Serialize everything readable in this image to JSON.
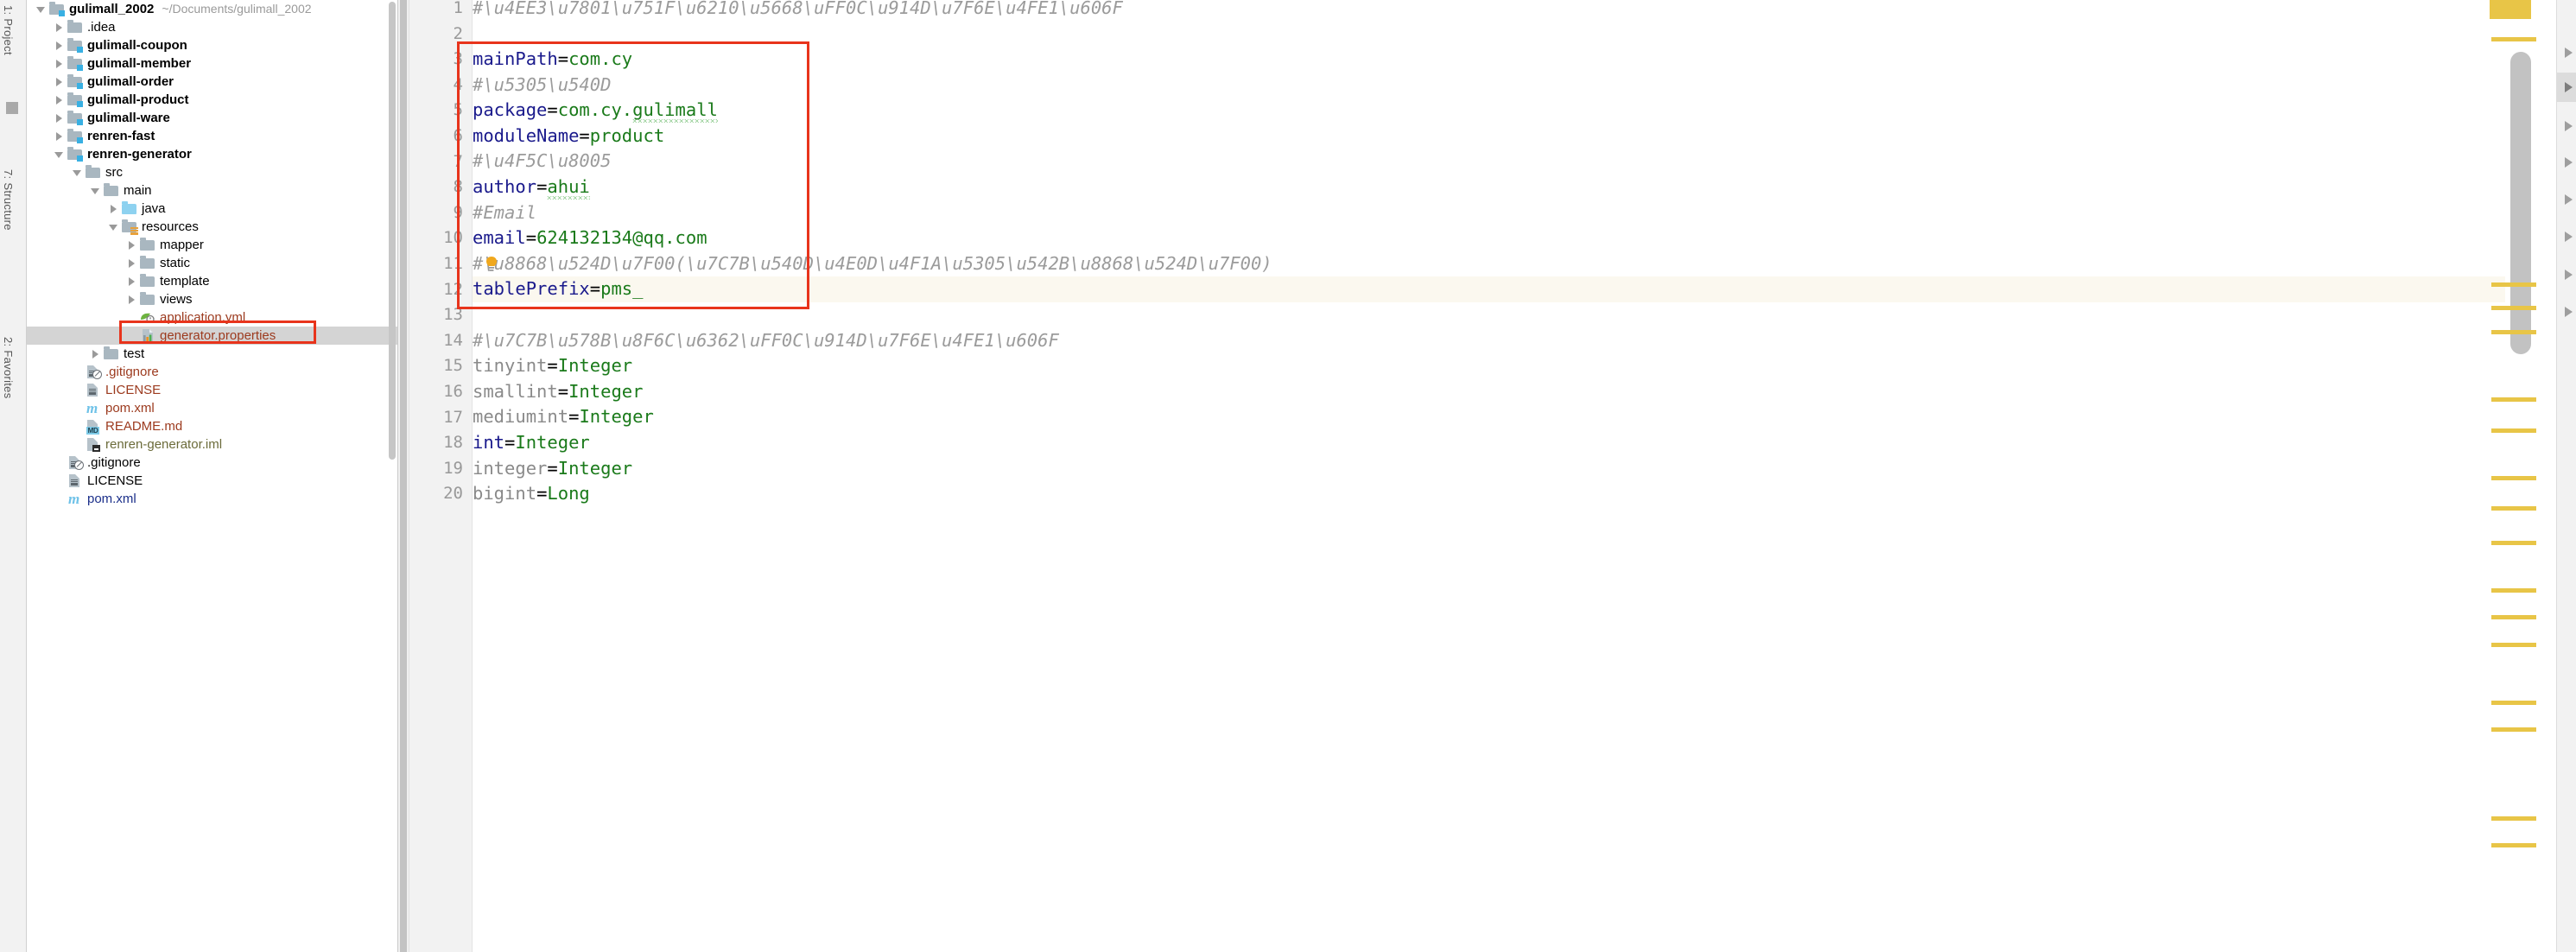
{
  "left_strip": {
    "tabs": [
      {
        "label": "1: Project"
      },
      {
        "label": "7: Structure"
      },
      {
        "label": "2: Favorites"
      }
    ]
  },
  "project_tree": {
    "panel_name": "Project",
    "items": [
      {
        "indent": 0,
        "arrow": "open",
        "icon": "module-folder-icon",
        "label": "gulimall_2002",
        "bold": true,
        "color": "black",
        "path": "~/Documents/gulimall_2002",
        "selected": false
      },
      {
        "indent": 1,
        "arrow": "closed",
        "icon": "folder-icon",
        "label": ".idea",
        "bold": false,
        "color": "black",
        "path": "",
        "selected": false
      },
      {
        "indent": 1,
        "arrow": "closed",
        "icon": "module-folder-icon",
        "label": "gulimall-coupon",
        "bold": true,
        "color": "black",
        "path": "",
        "selected": false
      },
      {
        "indent": 1,
        "arrow": "closed",
        "icon": "module-folder-icon",
        "label": "gulimall-member",
        "bold": true,
        "color": "black",
        "path": "",
        "selected": false
      },
      {
        "indent": 1,
        "arrow": "closed",
        "icon": "module-folder-icon",
        "label": "gulimall-order",
        "bold": true,
        "color": "black",
        "path": "",
        "selected": false
      },
      {
        "indent": 1,
        "arrow": "closed",
        "icon": "module-folder-icon",
        "label": "gulimall-product",
        "bold": true,
        "color": "black",
        "path": "",
        "selected": false
      },
      {
        "indent": 1,
        "arrow": "closed",
        "icon": "module-folder-icon",
        "label": "gulimall-ware",
        "bold": true,
        "color": "black",
        "path": "",
        "selected": false
      },
      {
        "indent": 1,
        "arrow": "closed",
        "icon": "module-folder-icon",
        "label": "renren-fast",
        "bold": true,
        "color": "black",
        "path": "",
        "selected": false
      },
      {
        "indent": 1,
        "arrow": "open",
        "icon": "module-folder-icon",
        "label": "renren-generator",
        "bold": true,
        "color": "black",
        "path": "",
        "selected": false
      },
      {
        "indent": 2,
        "arrow": "open",
        "icon": "folder-icon",
        "label": "src",
        "bold": false,
        "color": "black",
        "path": "",
        "selected": false
      },
      {
        "indent": 3,
        "arrow": "open",
        "icon": "folder-icon",
        "label": "main",
        "bold": false,
        "color": "black",
        "path": "",
        "selected": false
      },
      {
        "indent": 4,
        "arrow": "closed",
        "icon": "source-root-folder-icon",
        "label": "java",
        "bold": false,
        "color": "black",
        "path": "",
        "selected": false
      },
      {
        "indent": 4,
        "arrow": "open",
        "icon": "resource-root-folder-icon",
        "label": "resources",
        "bold": false,
        "color": "black",
        "path": "",
        "selected": false
      },
      {
        "indent": 5,
        "arrow": "closed",
        "icon": "folder-icon",
        "label": "mapper",
        "bold": false,
        "color": "black",
        "path": "",
        "selected": false
      },
      {
        "indent": 5,
        "arrow": "closed",
        "icon": "folder-icon",
        "label": "static",
        "bold": false,
        "color": "black",
        "path": "",
        "selected": false
      },
      {
        "indent": 5,
        "arrow": "closed",
        "icon": "folder-icon",
        "label": "template",
        "bold": false,
        "color": "black",
        "path": "",
        "selected": false
      },
      {
        "indent": 5,
        "arrow": "closed",
        "icon": "folder-icon",
        "label": "views",
        "bold": false,
        "color": "black",
        "path": "",
        "selected": false
      },
      {
        "indent": 5,
        "arrow": "none",
        "icon": "yaml-spring-file-icon",
        "label": "application.yml",
        "bold": false,
        "color": "red",
        "path": "",
        "selected": false
      },
      {
        "indent": 5,
        "arrow": "none",
        "icon": "properties-file-icon",
        "label": "generator.properties",
        "bold": false,
        "color": "red",
        "path": "",
        "selected": true
      },
      {
        "indent": 3,
        "arrow": "closed",
        "icon": "folder-icon",
        "label": "test",
        "bold": false,
        "color": "black",
        "path": "",
        "selected": false
      },
      {
        "indent": 2,
        "arrow": "none",
        "icon": "gitignore-file-icon",
        "label": ".gitignore",
        "bold": false,
        "color": "red",
        "path": "",
        "selected": false
      },
      {
        "indent": 2,
        "arrow": "none",
        "icon": "text-file-icon",
        "label": "LICENSE",
        "bold": false,
        "color": "red",
        "path": "",
        "selected": false
      },
      {
        "indent": 2,
        "arrow": "none",
        "icon": "maven-file-icon",
        "label": "pom.xml",
        "bold": false,
        "color": "red",
        "path": "",
        "selected": false
      },
      {
        "indent": 2,
        "arrow": "none",
        "icon": "markdown-file-icon",
        "label": "README.md",
        "bold": false,
        "color": "red",
        "path": "",
        "selected": false
      },
      {
        "indent": 2,
        "arrow": "none",
        "icon": "iml-file-icon",
        "label": "renren-generator.iml",
        "bold": false,
        "color": "olive",
        "path": "",
        "selected": false
      },
      {
        "indent": 1,
        "arrow": "none",
        "icon": "gitignore-file-icon",
        "label": ".gitignore",
        "bold": false,
        "color": "black",
        "path": "",
        "selected": false
      },
      {
        "indent": 1,
        "arrow": "none",
        "icon": "text-file-icon",
        "label": "LICENSE",
        "bold": false,
        "color": "black",
        "path": "",
        "selected": false
      },
      {
        "indent": 1,
        "arrow": "none",
        "icon": "maven-file-icon",
        "label": "pom.xml",
        "bold": false,
        "color": "blue",
        "path": "",
        "selected": false
      }
    ]
  },
  "editor": {
    "file_label": "generator.properties",
    "highlight_color": "#e8341c",
    "lines": [
      {
        "no": "1",
        "tokens": [
          {
            "t": "#\\u4EE3\\u7801\\u751F\\u6210\\u5668\\uFF0C\\u914D\\u7F6E\\u4FE1\\u606F",
            "c": "cmt"
          }
        ]
      },
      {
        "no": "2",
        "tokens": []
      },
      {
        "no": "3",
        "tokens": [
          {
            "t": "mainPath",
            "c": "kw"
          },
          {
            "t": "=",
            "c": "eq"
          },
          {
            "t": "com.cy",
            "c": "val"
          }
        ]
      },
      {
        "no": "4",
        "tokens": [
          {
            "t": "#\\u5305\\u540D",
            "c": "cmt"
          }
        ]
      },
      {
        "no": "5",
        "tokens": [
          {
            "t": "package",
            "c": "kw"
          },
          {
            "t": "=",
            "c": "eq"
          },
          {
            "t": "com.cy.",
            "c": "val"
          },
          {
            "t": "gulimall",
            "c": "val typo"
          }
        ]
      },
      {
        "no": "6",
        "tokens": [
          {
            "t": "moduleName",
            "c": "kw"
          },
          {
            "t": "=",
            "c": "eq"
          },
          {
            "t": "product",
            "c": "val"
          }
        ]
      },
      {
        "no": "7",
        "tokens": [
          {
            "t": "#\\u4F5C\\u8005",
            "c": "cmt"
          }
        ]
      },
      {
        "no": "8",
        "tokens": [
          {
            "t": "author",
            "c": "kw"
          },
          {
            "t": "=",
            "c": "eq"
          },
          {
            "t": "ahui",
            "c": "val typo"
          }
        ]
      },
      {
        "no": "9",
        "tokens": [
          {
            "t": "#Email",
            "c": "cmt"
          }
        ]
      },
      {
        "no": "10",
        "tokens": [
          {
            "t": "email",
            "c": "kw"
          },
          {
            "t": "=",
            "c": "eq"
          },
          {
            "t": "624132134@qq.com",
            "c": "val"
          }
        ]
      },
      {
        "no": "11",
        "tokens": [
          {
            "t": "#\\u8868\\u524D\\u7F00(\\u7C7B\\u540D\\u4E0D\\u4F1A\\u5305\\u542B\\u8868\\u524D\\u7F00)",
            "c": "cmt"
          }
        ]
      },
      {
        "no": "12",
        "tokens": [
          {
            "t": "tablePrefix",
            "c": "kw"
          },
          {
            "t": "=",
            "c": "eq"
          },
          {
            "t": "pms_",
            "c": "val"
          }
        ]
      },
      {
        "no": "13",
        "tokens": []
      },
      {
        "no": "14",
        "tokens": [
          {
            "t": "#\\u7C7B\\u578B\\u8F6C\\u6362\\uFF0C\\u914D\\u7F6E\\u4FE1\\u606F",
            "c": "cmt"
          }
        ]
      },
      {
        "no": "15",
        "tokens": [
          {
            "t": "tinyint",
            "c": "kw-gray"
          },
          {
            "t": "=",
            "c": "eq"
          },
          {
            "t": "Integer",
            "c": "val"
          }
        ]
      },
      {
        "no": "16",
        "tokens": [
          {
            "t": "smallint",
            "c": "kw-gray"
          },
          {
            "t": "=",
            "c": "eq"
          },
          {
            "t": "Integer",
            "c": "val"
          }
        ]
      },
      {
        "no": "17",
        "tokens": [
          {
            "t": "mediumint",
            "c": "kw-gray"
          },
          {
            "t": "=",
            "c": "eq"
          },
          {
            "t": "Integer",
            "c": "val"
          }
        ]
      },
      {
        "no": "18",
        "tokens": [
          {
            "t": "int",
            "c": "kw"
          },
          {
            "t": "=",
            "c": "eq"
          },
          {
            "t": "Integer",
            "c": "val"
          }
        ]
      },
      {
        "no": "19",
        "tokens": [
          {
            "t": "integer",
            "c": "kw-gray"
          },
          {
            "t": "=",
            "c": "eq"
          },
          {
            "t": "Integer",
            "c": "val"
          }
        ]
      },
      {
        "no": "20",
        "tokens": [
          {
            "t": "bigint",
            "c": "kw-gray"
          },
          {
            "t": "=",
            "c": "eq"
          },
          {
            "t": "Long",
            "c": "val"
          }
        ]
      }
    ],
    "caret_line": 12,
    "intention_bulb_line": 11,
    "bulb_icon": "lightbulb-icon",
    "stripe_marks_pct": [
      5.5,
      41.5,
      45,
      48.5,
      58.5,
      63,
      70,
      74.5,
      79.5,
      86.5,
      90.5,
      94.5,
      103,
      107,
      120,
      124
    ],
    "right_tool_arrows": 8
  }
}
